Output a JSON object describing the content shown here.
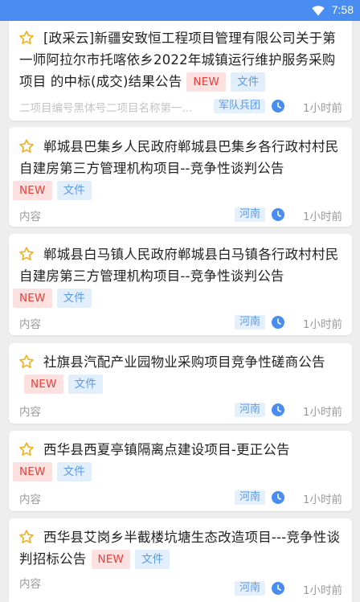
{
  "status": {
    "time": "7:58"
  },
  "items": [
    {
      "title": "[政采云]新疆安致恒工程项目管理有限公司关于第一师阿拉尔市托喀依乡2022年城镇运行维护服务采购项目 的中标(成交)结果公告",
      "new": "NEW",
      "doc": "文件",
      "sub": "二项目编号黑体号二项目名称第一...",
      "region": "军队兵团",
      "ago": "1小时前"
    },
    {
      "title": "郸城县巴集乡人民政府郸城县巴集乡各行政村村民自建房第三方管理机构项目--竞争性谈判公告",
      "new": "NEW",
      "doc": "文件",
      "sub": "内容",
      "region": "河南",
      "ago": "1小时前"
    },
    {
      "title": "郸城县白马镇人民政府郸城县白马镇各行政村村民自建房第三方管理机构项目--竞争性谈判公告",
      "new": "NEW",
      "doc": "文件",
      "sub": "内容",
      "region": "河南",
      "ago": "1小时前"
    },
    {
      "title": "社旗县汽配产业园物业采购项目竞争性磋商公告",
      "new": "NEW",
      "doc": "文件",
      "sub": "内容",
      "region": "河南",
      "ago": "1小时前"
    },
    {
      "title": "西华县西夏亭镇隔离点建设项目-更正公告",
      "new": "NEW",
      "doc": "文件",
      "sub": "内容",
      "region": "河南",
      "ago": "1小时前"
    },
    {
      "title": "西华县艾岗乡半截楼坑塘生态改造项目---竞争性谈判招标公告",
      "new": "NEW",
      "doc": "文件",
      "sub": "内容",
      "region": "河南",
      "ago": "1小时前"
    }
  ]
}
